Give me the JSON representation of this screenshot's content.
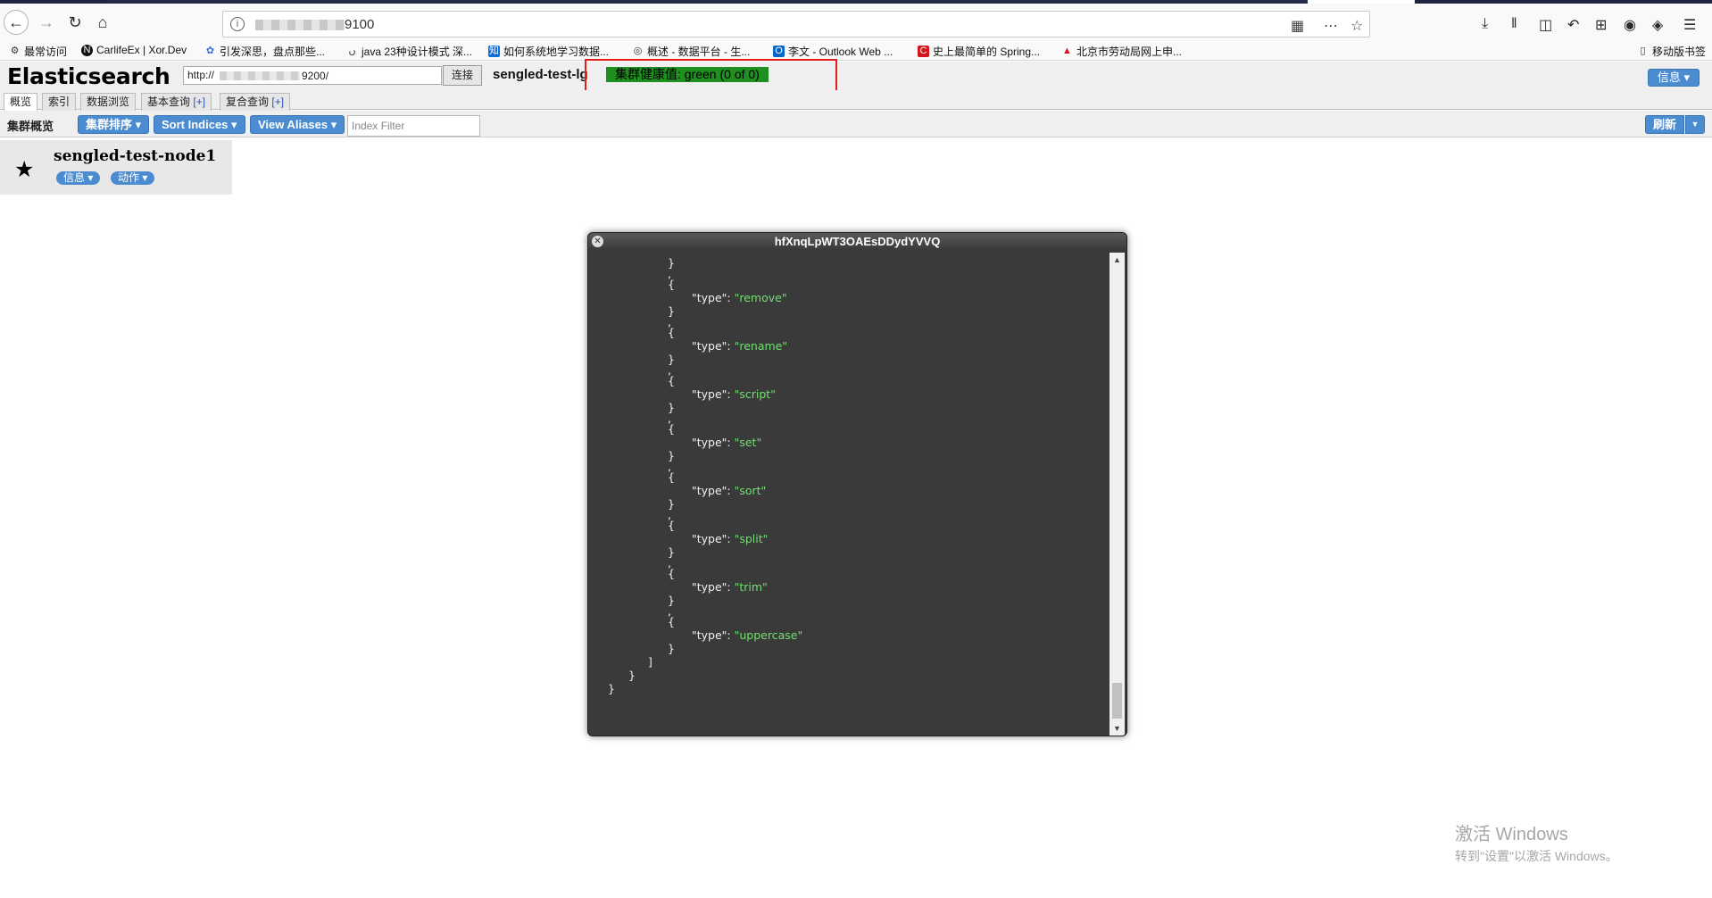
{
  "browser": {
    "url": "9100",
    "bookmarks": [
      {
        "label": "最常访问",
        "icon": "gear-icon"
      },
      {
        "label": "CarlifeEx | Xor.Dev",
        "icon": "n-logo-icon"
      },
      {
        "label": "引发深思，盘点那些...",
        "icon": "baidu-paw-icon"
      },
      {
        "label": "java 23种设计模式 深...",
        "icon": "csdn-icon"
      },
      {
        "label": "如何系统地学习数据...",
        "icon": "zhihu-icon"
      },
      {
        "label": "概述 - 数据平台 - 生...",
        "icon": "globe-icon"
      },
      {
        "label": "李文 - Outlook Web ...",
        "icon": "outlook-icon"
      },
      {
        "label": "史上最简单的 Spring...",
        "icon": "c-logo-icon"
      },
      {
        "label": "北京市劳动局网上申...",
        "icon": "gov-icon"
      }
    ],
    "mobile_bookmarks": "移动版书签"
  },
  "es": {
    "title": "Elasticsearch",
    "connect_url": "http://",
    "connect_url_tail": "9200/",
    "connect_label": "连接",
    "cluster_name": "sengled-test-lg",
    "health": "集群健康值: green (0 of 0)",
    "info_label": "信息",
    "tabs": [
      {
        "label": "概览"
      },
      {
        "label": "索引"
      },
      {
        "label": "数据浏览"
      },
      {
        "label": "基本查询",
        "plus": "[+]"
      },
      {
        "label": "复合查询",
        "plus": "[+]"
      }
    ],
    "toolbar": {
      "label": "集群概览",
      "sort_cluster": "集群排序",
      "sort_indices": "Sort Indices",
      "view_aliases": "View Aliases",
      "index_filter_placeholder": "Index Filter",
      "refresh": "刷新"
    },
    "node": {
      "name": "sengled-test-node1",
      "info_btn": "信息",
      "action_btn": "动作"
    }
  },
  "modal": {
    "title": "hfXnqLpWT3OAEsDDydYVVQ",
    "processor_types": [
      "remove",
      "rename",
      "script",
      "set",
      "sort",
      "split",
      "trim",
      "uppercase"
    ]
  },
  "watermark": {
    "title": "激活 Windows",
    "subtitle": "转到\"设置\"以激活 Windows。"
  }
}
